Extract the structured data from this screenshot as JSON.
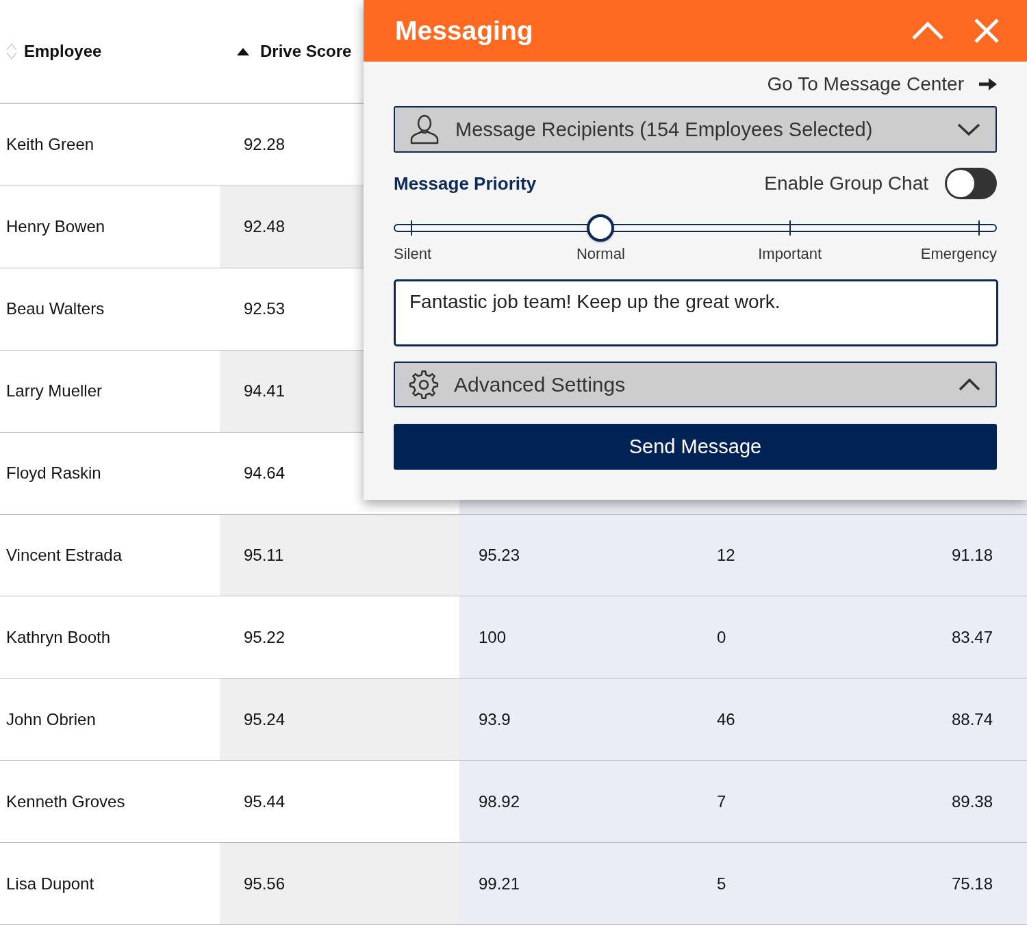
{
  "table": {
    "columns": [
      {
        "label": "Employee",
        "sorted": false
      },
      {
        "label": "Drive Score",
        "sorted": true
      }
    ],
    "rows": [
      {
        "employee": "Keith Green",
        "drive_score": "92.28"
      },
      {
        "employee": "Henry Bowen",
        "drive_score": "92.48"
      },
      {
        "employee": "Beau Walters",
        "drive_score": "92.53"
      },
      {
        "employee": "Larry Mueller",
        "drive_score": "94.41"
      },
      {
        "employee": "Floyd Raskin",
        "drive_score": "94.64"
      },
      {
        "employee": "Vincent Estrada",
        "drive_score": "95.11",
        "column_3": "95.23",
        "column_4": "12",
        "column_5": "91.18"
      },
      {
        "employee": "Kathryn Booth",
        "drive_score": "95.22",
        "column_3": "100",
        "column_4": "0",
        "column_5": "83.47"
      },
      {
        "employee": "John Obrien",
        "drive_score": "95.24",
        "column_3": "93.9",
        "column_4": "46",
        "column_5": "88.74"
      },
      {
        "employee": "Kenneth Groves",
        "drive_score": "95.44",
        "column_3": "98.92",
        "column_4": "7",
        "column_5": "89.38"
      },
      {
        "employee": "Lisa Dupont",
        "drive_score": "95.56",
        "column_3": "99.21",
        "column_4": "5",
        "column_5": "75.18"
      }
    ]
  },
  "messaging": {
    "title": "Messaging",
    "message_center_link": "Go To Message Center",
    "recipients": "Message Recipients (154 Employees Selected)",
    "priority": {
      "label": "Message Priority",
      "level": 0.333,
      "stops": [
        "Silent",
        "Normal",
        "Important",
        "Emergency"
      ]
    },
    "group_chat": {
      "label": "Enable Group Chat",
      "on": false
    },
    "message": "Fantastic job team! Keep up the great work.",
    "advanced_settings": "Advanced Settings",
    "send_button": "Send Message"
  }
}
